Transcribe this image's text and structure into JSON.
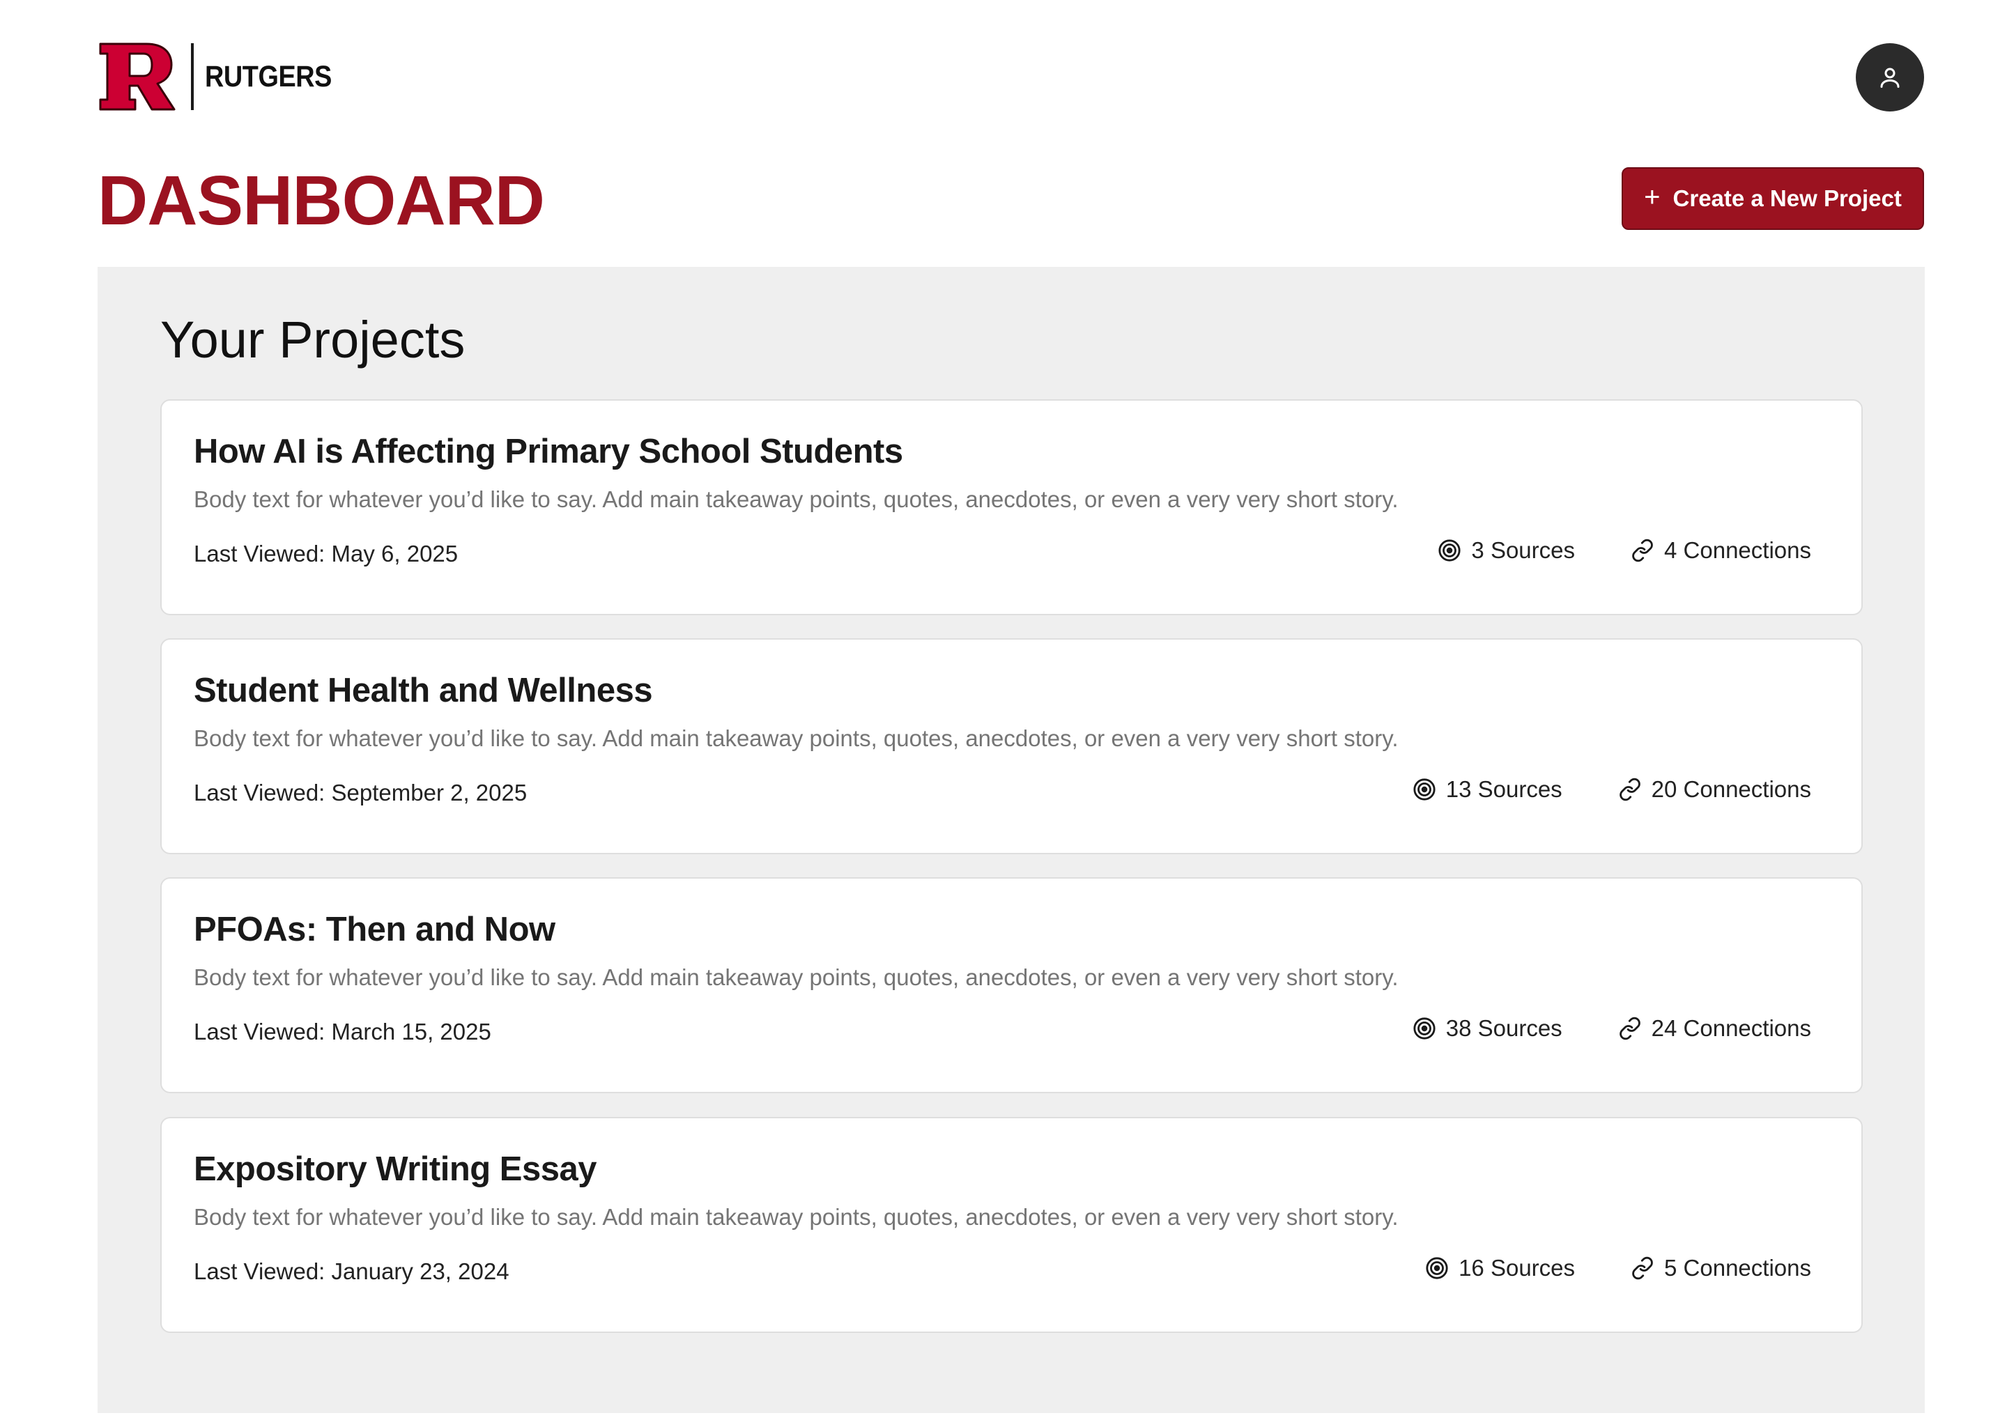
{
  "brand": {
    "wordmark": "RUTGERS"
  },
  "header": {
    "title": "DASHBOARD",
    "create_button_label": "Create a New Project"
  },
  "projects_section": {
    "title": "Your Projects"
  },
  "projects": [
    {
      "title": "How AI is Affecting Primary School Students",
      "body": "Body text for whatever you’d like to say. Add main takeaway points, quotes, anecdotes, or even a very very short story.",
      "last_viewed": "Last Viewed: May 6, 2025",
      "sources": "3 Sources",
      "connections": "4 Connections"
    },
    {
      "title": "Student Health and Wellness",
      "body": "Body text for whatever you’d like to say. Add main takeaway points, quotes, anecdotes, or even a very very short story.",
      "last_viewed": "Last Viewed: September 2, 2025",
      "sources": "13 Sources",
      "connections": "20 Connections"
    },
    {
      "title": "PFOAs: Then and Now",
      "body": "Body text for whatever you’d like to say. Add main takeaway points, quotes, anecdotes, or even a very very short story.",
      "last_viewed": "Last Viewed: March 15, 2025",
      "sources": "38 Sources",
      "connections": "24 Connections"
    },
    {
      "title": "Expository Writing Essay",
      "body": "Body text for whatever you’d like to say. Add main takeaway points, quotes, anecdotes, or even a very very short story.",
      "last_viewed": "Last Viewed: January 23, 2024",
      "sources": "16 Sources",
      "connections": "5 Connections"
    }
  ],
  "icons": {
    "logo": "rutgers-r-logo",
    "avatar": "user-icon",
    "create": "plus-icon",
    "sources": "target-icon",
    "connections": "link-icon"
  },
  "colors": {
    "brand_red": "#9b1220",
    "panel_bg": "#efefef",
    "avatar_bg": "#2b2b2b",
    "body_text": "#757575"
  }
}
